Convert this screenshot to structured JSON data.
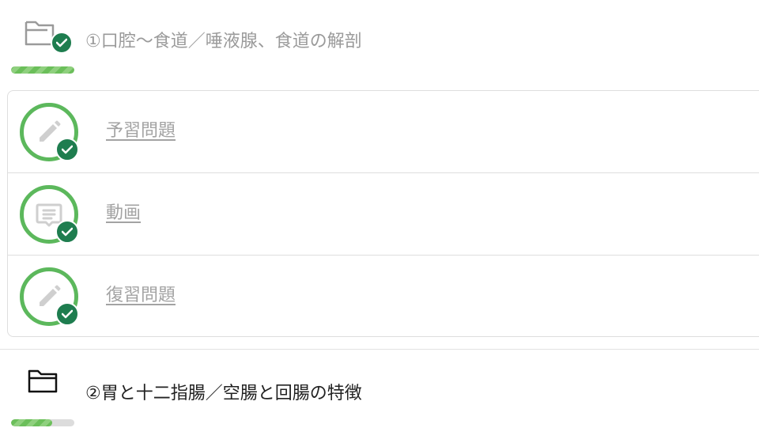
{
  "sections": [
    {
      "title": "①口腔～食道／唾液腺、食道の解剖",
      "status": "completed",
      "icon": "folder-open-icon",
      "progress": 1.0,
      "lessons": [
        {
          "label": "予習問題",
          "icon": "pencil-icon",
          "completed": true
        },
        {
          "label": "動画",
          "icon": "video-book-icon",
          "completed": true
        },
        {
          "label": "復習問題",
          "icon": "pencil-icon",
          "completed": true
        }
      ]
    },
    {
      "title": "②胃と十二指腸／空腸と回腸の特徴",
      "status": "in-progress",
      "icon": "folder-icon",
      "progress": 0.65
    }
  ],
  "colors": {
    "progress_green": "#6bbf5a",
    "ring_green": "#5cb85c",
    "check_green": "#1e7d4f",
    "muted_text": "#9a9a9a",
    "active_text": "#222222"
  }
}
